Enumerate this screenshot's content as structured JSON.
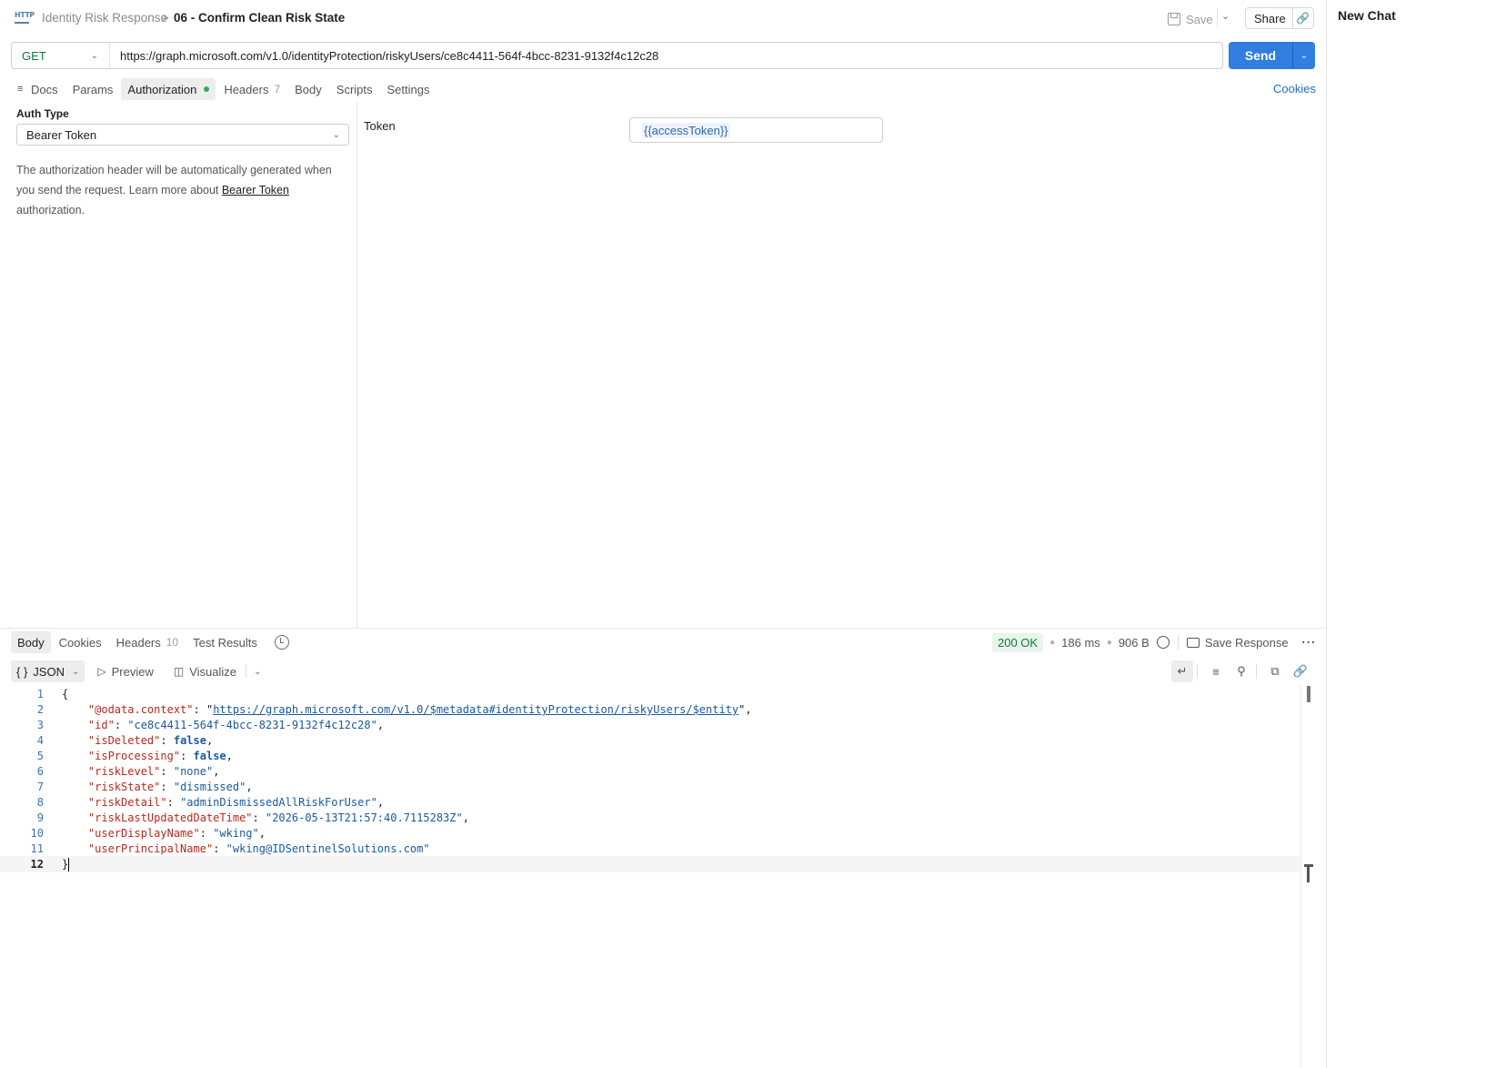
{
  "header": {
    "breadcrumb_parent": "Identity Risk Response",
    "breadcrumb_sep": ">",
    "breadcrumb_current": "06 - Confirm Clean Risk State",
    "http_icon_text": "HTTP",
    "save_label": "Save",
    "share_label": "Share"
  },
  "request": {
    "method": "GET",
    "url": "https://graph.microsoft.com/v1.0/identityProtection/riskyUsers/ce8c4411-564f-4bcc-8231-9132f4c12c28",
    "send_label": "Send",
    "tabs": [
      {
        "label": "Docs"
      },
      {
        "label": "Params"
      },
      {
        "label": "Authorization",
        "active": true,
        "indicator": "green-dot"
      },
      {
        "label": "Headers",
        "count": "7"
      },
      {
        "label": "Body"
      },
      {
        "label": "Scripts"
      },
      {
        "label": "Settings"
      }
    ],
    "cookies_label": "Cookies"
  },
  "auth": {
    "type_label": "Auth Type",
    "type_value": "Bearer Token",
    "description_1": "The authorization header will be automatically generated when you send the request. Learn more about ",
    "description_link": "Bearer Token",
    "description_2": " authorization.",
    "token_label": "Token",
    "token_value": "{{accessToken}}"
  },
  "response": {
    "tabs": [
      {
        "label": "Body",
        "active": true
      },
      {
        "label": "Cookies"
      },
      {
        "label": "Headers",
        "count": "10"
      },
      {
        "label": "Test Results"
      }
    ],
    "status": "200 OK",
    "time": "186 ms",
    "size": "906 B",
    "save_response_label": "Save Response",
    "format": "JSON",
    "preview_label": "Preview",
    "visualize_label": "Visualize",
    "status_color": "#137a3e"
  },
  "json_body": {
    "odata_context_key": "\"@odata.context\"",
    "odata_context_value": "https://graph.microsoft.com/v1.0/$metadata#identityProtection/riskyUsers/$entity",
    "id_key": "\"id\"",
    "id_value": "\"ce8c4411-564f-4bcc-8231-9132f4c12c28\"",
    "isDeleted_key": "\"isDeleted\"",
    "isDeleted_value": "false",
    "isProcessing_key": "\"isProcessing\"",
    "isProcessing_value": "false",
    "riskLevel_key": "\"riskLevel\"",
    "riskLevel_value": "\"none\"",
    "riskState_key": "\"riskState\"",
    "riskState_value": "\"dismissed\"",
    "riskDetail_key": "\"riskDetail\"",
    "riskDetail_value": "\"adminDismissedAllRiskForUser\"",
    "riskLastUpdatedDateTime_key": "\"riskLastUpdatedDateTime\"",
    "riskLastUpdatedDateTime_value": "\"2026-05-13T21:57:40.7115283Z\"",
    "userDisplayName_key": "\"userDisplayName\"",
    "userDisplayName_value": "\"wking\"",
    "userPrincipalName_key": "\"userPrincipalName\"",
    "userPrincipalName_value": "\"wking@IDSentinelSolutions.com\""
  },
  "line_numbers": [
    "1",
    "2",
    "3",
    "4",
    "5",
    "6",
    "7",
    "8",
    "9",
    "10",
    "11",
    "12"
  ],
  "right_panel": {
    "title": "New Chat"
  }
}
